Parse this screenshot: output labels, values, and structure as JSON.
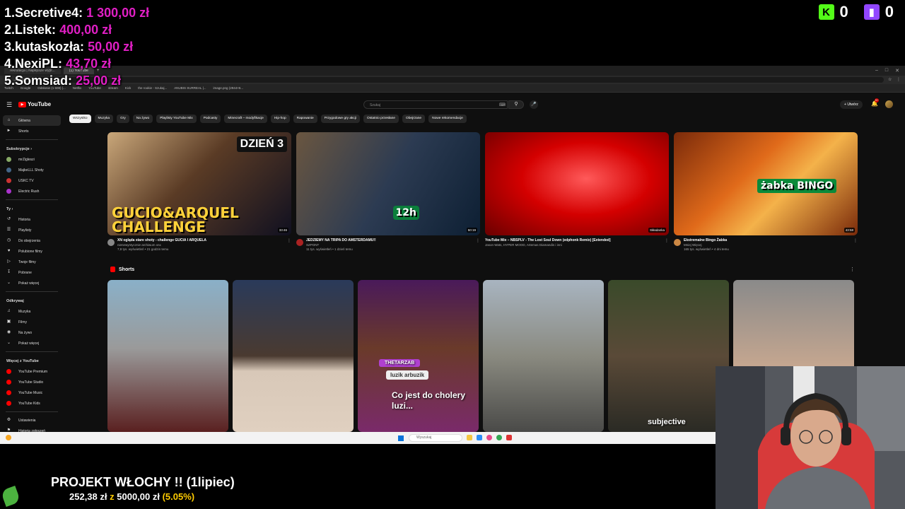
{
  "leaderboard": [
    {
      "rank": "1.",
      "name": "Secretive4:",
      "amount": "1 300,00 zł"
    },
    {
      "rank": "2.",
      "name": "Listek:",
      "amount": "400,00 zł"
    },
    {
      "rank": "3.",
      "name": "kutaskozła:",
      "amount": "50,00 zł"
    },
    {
      "rank": "4.",
      "name": "NexiPL:",
      "amount": "43,70 zł"
    },
    {
      "rank": "5.",
      "name": "Somsiad:",
      "amount": "25,00 zł"
    }
  ],
  "platforms": {
    "kick": {
      "letter": "K",
      "count": "0",
      "color": "#53fc18"
    },
    "twitch": {
      "count": "0",
      "color": "#9146ff"
    }
  },
  "browser": {
    "tabs": [
      "rekrutacja | Najlepsze wypr...",
      "(1) YouTube"
    ],
    "bookmarks": [
      "Twitch",
      "Google",
      "Odsłonie (1 608) |...",
      "Netflix",
      "YouTube",
      "stream",
      "Kick",
      "the rookie - Szukaj...",
      "ANUBIS SURREAL |...",
      "image.png (2944×6..."
    ]
  },
  "youtube": {
    "logo": "YouTube",
    "search_placeholder": "Szukaj",
    "create_label": "Utwórz",
    "notifications": "9+",
    "chips": [
      "Wszystko",
      "Muzyka",
      "Gry",
      "Na żywo",
      "Playlisty YouTube Mix",
      "Podcasty",
      "Minecraft – modyfikacje",
      "Hip-hop",
      "Rapowanie",
      "Przygodowe gry akcji",
      "Ostatnio przesłane",
      "Obejrzane",
      "Nowe rekomendacje"
    ],
    "sidebar": {
      "top": [
        {
          "icon": "home-icon",
          "label": "Główna",
          "active": true
        },
        {
          "icon": "shorts-icon",
          "label": "Shorts"
        }
      ],
      "subs_head": "Subskrypcje",
      "subs": [
        "mrZigleszi",
        "MajkeLLL Shoty",
        "USKC TV",
        "Electric Rush"
      ],
      "you_head": "Ty",
      "you": [
        "Historia",
        "Playlisty",
        "Do obejrzenia",
        "Polubione filmy",
        "Twoje filmy",
        "Pobrane",
        "Pokaż więcej"
      ],
      "explore_head": "Odkrywaj",
      "explore": [
        "Muzyka",
        "Filmy",
        "Na żywo",
        "Pokaż więcej"
      ],
      "more_head": "Więcej z YouTube",
      "more": [
        "YouTube Premium",
        "YouTube Studio",
        "YouTube Music",
        "YouTube Kids"
      ],
      "bottom": [
        "Ustawienia",
        "Historia zgłoszeń"
      ]
    },
    "videos": [
      {
        "title": "XN ogląda stare shoty - challenge GUCIA I ARQUELA",
        "channel": "nienewyntycznie archiwum xnx",
        "stats": "7,8 tys. wyświetleń • 21 godzin temu",
        "duration": "33:46",
        "overlay": "GUCIO&ARQUEL CHALLENGE",
        "badge": "DZIEŃ 3"
      },
      {
        "title": "JEDZIEMY NA TRIPA DO AMSTERDAMU!!",
        "channel": "SZPONT",
        "stats": "11 tys. wyświetleń • 1 dzień temu",
        "duration": "50:19",
        "overlay": "12h",
        "badge": ""
      },
      {
        "title": "YouTube Mix – NBSPLV - The Lost Soul Down (edphonk Remix) [Extended]",
        "channel": "Jason Wats, HYPER MOOD, Artemas Diamandis i inni",
        "stats": "",
        "duration": "Składanka",
        "overlay": "",
        "badge": ""
      },
      {
        "title": "Ekstremalne Bingo Żabka",
        "channel": "Mniej Więcej",
        "stats": "165 tys. wyświetleń • 4 dni temu",
        "duration": "43:58",
        "overlay": "żabka BINGO",
        "badge": ""
      }
    ],
    "shorts_label": "Shorts",
    "shorts": [
      {
        "caption": ""
      },
      {
        "caption": ""
      },
      {
        "caption": "Co jest do cholery luzi...",
        "tag": "THETARZAB",
        "sub": "luzik arbuzik"
      },
      {
        "caption": ""
      },
      {
        "caption": "subjective"
      },
      {
        "caption": ""
      }
    ]
  },
  "taskbar": {
    "search_placeholder": "Wyszukaj"
  },
  "goal": {
    "title": "PROJEKT WŁOCHY !! (1lipiec)",
    "current": "252,38 zł",
    "sep": "z",
    "target": "5000,00 zł",
    "percent": "(5.05%)"
  }
}
